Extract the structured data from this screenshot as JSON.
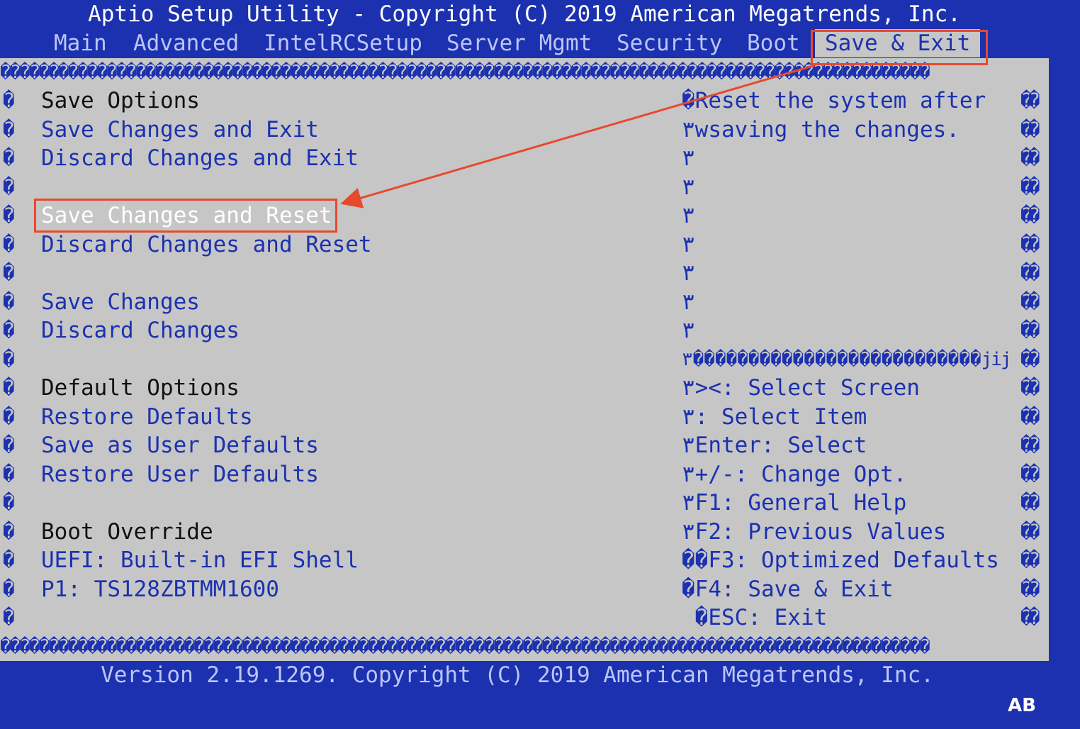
{
  "title": "Aptio Setup Utility - Copyright (C) 2019 American Megatrends, Inc.",
  "tabs": [
    {
      "label": "Main"
    },
    {
      "label": "Advanced"
    },
    {
      "label": "IntelRCSetup"
    },
    {
      "label": "Server Mgmt"
    },
    {
      "label": "Security"
    },
    {
      "label": "Boot"
    },
    {
      "label": "Save & Exit"
    }
  ],
  "active_tab": "Save & Exit",
  "border_glyphs": "������������������������������������������������������������������������������������������������",
  "left_glyph": "�",
  "right_glyph": "��",
  "menu": [
    {
      "label": "Save Options",
      "type": "header"
    },
    {
      "label": "Save Changes and Exit",
      "type": "item"
    },
    {
      "label": "Discard Changes and Exit",
      "type": "item"
    },
    {
      "label": "",
      "type": "blank"
    },
    {
      "label": "Save Changes and Reset",
      "type": "selected"
    },
    {
      "label": "Discard Changes and Reset",
      "type": "item"
    },
    {
      "label": "",
      "type": "blank"
    },
    {
      "label": "Save Changes",
      "type": "item"
    },
    {
      "label": "Discard Changes",
      "type": "item"
    },
    {
      "label": "",
      "type": "blank"
    },
    {
      "label": "Default Options",
      "type": "header"
    },
    {
      "label": "Restore Defaults",
      "type": "item"
    },
    {
      "label": "Save as User Defaults",
      "type": "item"
    },
    {
      "label": "Restore User Defaults",
      "type": "item"
    },
    {
      "label": "",
      "type": "blank"
    },
    {
      "label": "Boot Override",
      "type": "header"
    },
    {
      "label": "UEFI: Built-in EFI Shell",
      "type": "item"
    },
    {
      "label": "P1: TS128ZBTMM1600",
      "type": "item"
    },
    {
      "label": "",
      "type": "blank"
    }
  ],
  "help": [
    "�Reset the system after",
    "٣wsaving the changes.",
    "٣",
    "٣",
    "٣",
    "٣",
    "٣",
    "٣",
    "٣",
    "٣��������������������������jij",
    "٣><: Select Screen",
    "٣: Select Item",
    "٣Enter: Select",
    "٣+/-: Change Opt.",
    "٣F1: General Help",
    "٣F2: Previous Values",
    "��F3: Optimized Defaults",
    "�F4: Save & Exit",
    " �ESC: Exit"
  ],
  "footer": "Version 2.19.1269. Copyright (C) 2019 American Megatrends, Inc.",
  "corner_badge": "AB",
  "colors": {
    "background": "#1b31b0",
    "panel": "#c6c6c6",
    "annotation": "#e64a2e"
  }
}
